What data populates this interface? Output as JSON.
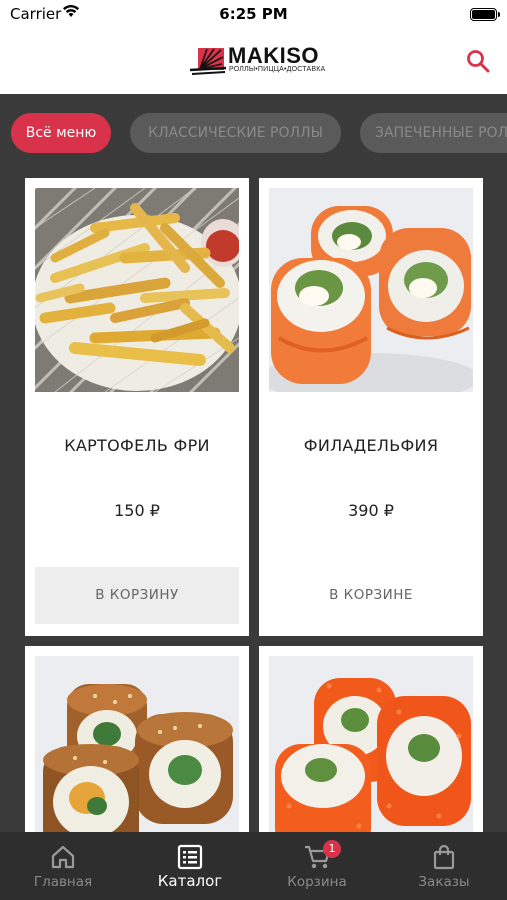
{
  "status_bar": {
    "carrier": "Carrier",
    "time": "6:25 PM"
  },
  "header": {
    "logo_title": "MAKISO",
    "logo_subtitle": "РОЛЛЫ•ПИЦЦА•ДОСТАВКА",
    "search_icon": "search-icon",
    "accent_color": "#d9334b"
  },
  "categories": [
    {
      "label": "Всё меню",
      "active": true
    },
    {
      "label": "КЛАССИЧЕСКИЕ РОЛЛЫ",
      "active": false
    },
    {
      "label": "ЗАПЕЧЕННЫЕ РОЛ",
      "active": false
    }
  ],
  "products": [
    {
      "name": "КАРТОФЕЛЬ ФРИ",
      "price": "150 ₽",
      "button": "В КОРЗИНУ",
      "image": "french-fries"
    },
    {
      "name": "ФИЛАДЕЛЬФИЯ",
      "price": "390 ₽",
      "button": "В КОРЗИНЕ",
      "image": "philadelphia-roll"
    },
    {
      "name": "",
      "price": "",
      "button": "",
      "image": "baked-eel-roll"
    },
    {
      "name": "",
      "price": "",
      "button": "",
      "image": "california-roll"
    }
  ],
  "tabbar": {
    "items": [
      {
        "label": "Главная",
        "icon": "home-icon",
        "active": false
      },
      {
        "label": "Каталог",
        "icon": "catalog-icon",
        "active": true
      },
      {
        "label": "Корзина",
        "icon": "cart-icon",
        "active": false,
        "badge": "1"
      },
      {
        "label": "Заказы",
        "icon": "bag-icon",
        "active": false
      }
    ]
  }
}
